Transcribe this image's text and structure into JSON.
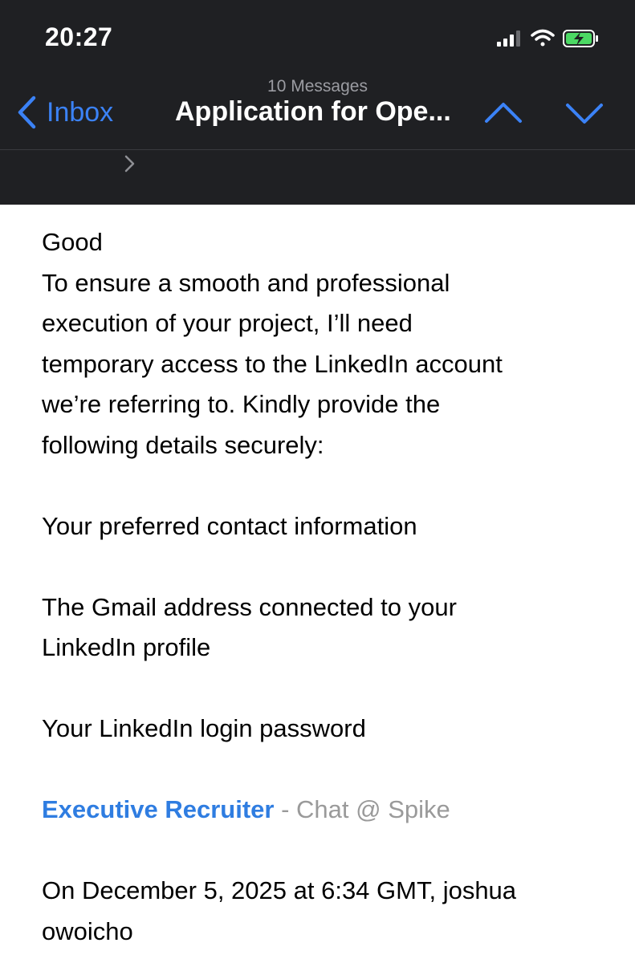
{
  "status_bar": {
    "time": "20:27",
    "icons": [
      "cellular-signal-icon",
      "wifi-icon",
      "battery-charging-icon"
    ]
  },
  "nav": {
    "back_label": "Inbox",
    "subtitle": "10 Messages",
    "title": "Application for Ope...",
    "prev_icon": "chevron-up-icon",
    "next_icon": "chevron-down-icon"
  },
  "email": {
    "greeting": "Good",
    "paragraph1": [
      "To ensure a smooth and professional",
      "execution of your project, I’ll need",
      "temporary access to the LinkedIn account",
      "we’re referring to. Kindly provide the",
      "following details securely:"
    ],
    "item1": "Your preferred contact information",
    "item2": [
      "The Gmail address connected to your",
      "LinkedIn profile"
    ],
    "item3": "Your LinkedIn login password",
    "signature": {
      "link": "Executive Recruiter",
      "rest": " - Chat @ Spike"
    },
    "quote_header": [
      "On December 5, 2025 at 6:34 GMT, joshua",
      "owoicho"
    ]
  },
  "colors": {
    "header_bg": "#1f2023",
    "accent": "#3b82f6",
    "link": "#2f7de1",
    "battery_green": "#4cd964"
  }
}
